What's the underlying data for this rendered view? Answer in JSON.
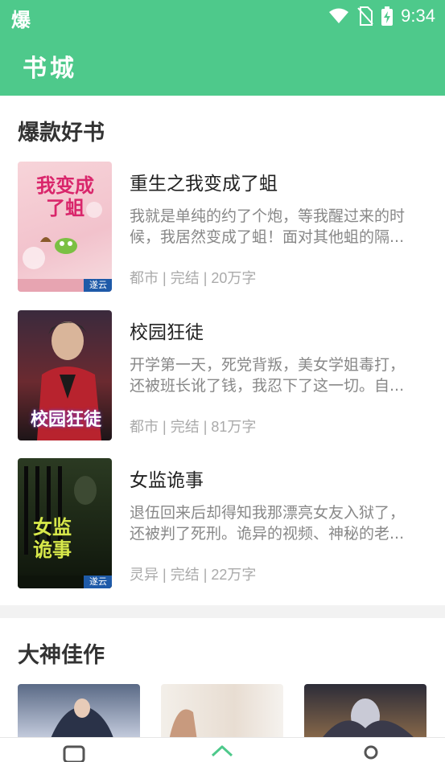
{
  "status_bar": {
    "left_glyph": "爆",
    "time": "9:34",
    "icons": [
      "wifi-icon",
      "no-sim-icon",
      "battery-charging-icon"
    ]
  },
  "app_bar": {
    "title": "书城"
  },
  "section1": {
    "title": "爆款好书",
    "books": [
      {
        "title": "重生之我变成了蛆",
        "desc_line1": "我就是单纯的约了个炮，等我醒过来的时",
        "desc_line2": "候，我居然变成了蛆！面对其他蛆的隔...",
        "category": "都市",
        "status": "完结",
        "words": "20万字",
        "cover_text": "我变成了蛆",
        "cover_badge": "遂云"
      },
      {
        "title": "校园狂徒",
        "desc_line1": "开学第一天，死党背叛，美女学姐毒打，",
        "desc_line2": "还被班长讹了钱，我忍下了这一切。自...",
        "category": "都市",
        "status": "完结",
        "words": "81万字",
        "cover_text": "校园狂徒"
      },
      {
        "title": "女监诡事",
        "desc_line1": "退伍回来后却得知我那漂亮女友入狱了，",
        "desc_line2": "还被判了死刑。诡异的视频、神秘的老...",
        "category": "灵异",
        "status": "完结",
        "words": "22万字",
        "cover_text": "女监诡事",
        "cover_badge": "遂云"
      }
    ]
  },
  "section2": {
    "title": "大神佳作"
  },
  "colors": {
    "brand": "#4ec98b",
    "title": "#222222",
    "desc": "#888888",
    "meta": "#aaaaaa"
  },
  "bottom_nav": [
    "bookshelf-icon",
    "home-icon",
    "profile-icon"
  ]
}
